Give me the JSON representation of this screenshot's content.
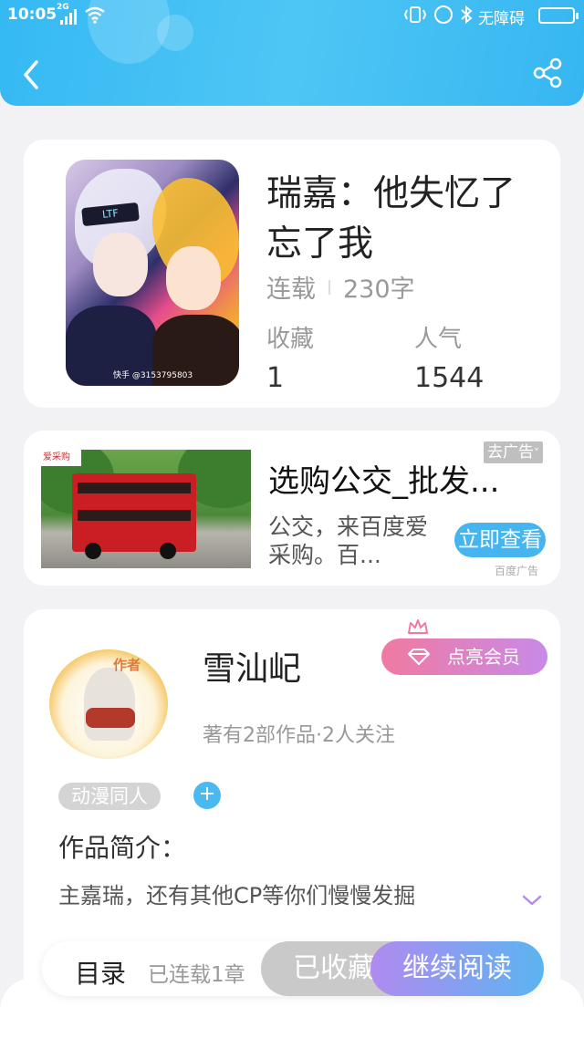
{
  "status_bar": {
    "time": "10:05",
    "network": "2G",
    "accessibility": "无障碍"
  },
  "header": {
    "back_icon": "chevron-left-icon",
    "share_icon": "share-icon",
    "background_color": "#35b9f3"
  },
  "book": {
    "title": "瑞嘉：他失忆了忘了我",
    "status": "连载",
    "word_count": "230字",
    "favorites_label": "收藏",
    "favorites_value": "1",
    "popularity_label": "人气",
    "popularity_value": "1544",
    "cover_visor_text": "LTF",
    "cover_credit": "快手 @3153795803"
  },
  "ad": {
    "image_logo": "爱采购",
    "title": "选购公交_批发...",
    "description": "公交，来百度爱采购。百...",
    "tag": "去广告",
    "cta": "立即查看",
    "source": "百度广告"
  },
  "author": {
    "avatar_tag": "作者",
    "name": "雪汕屺",
    "vip_button": "点亮会员",
    "stats": "著有2部作品·2人关注",
    "category": "动漫同人",
    "add_tag": "+",
    "intro_heading": "作品简介：",
    "intro_text": "主嘉瑞，还有其他CP等你们慢慢发掘"
  },
  "bottom_bar": {
    "toc": "目录",
    "serial": "已连载1章",
    "collected": "已收藏",
    "continue": "继续阅读"
  }
}
